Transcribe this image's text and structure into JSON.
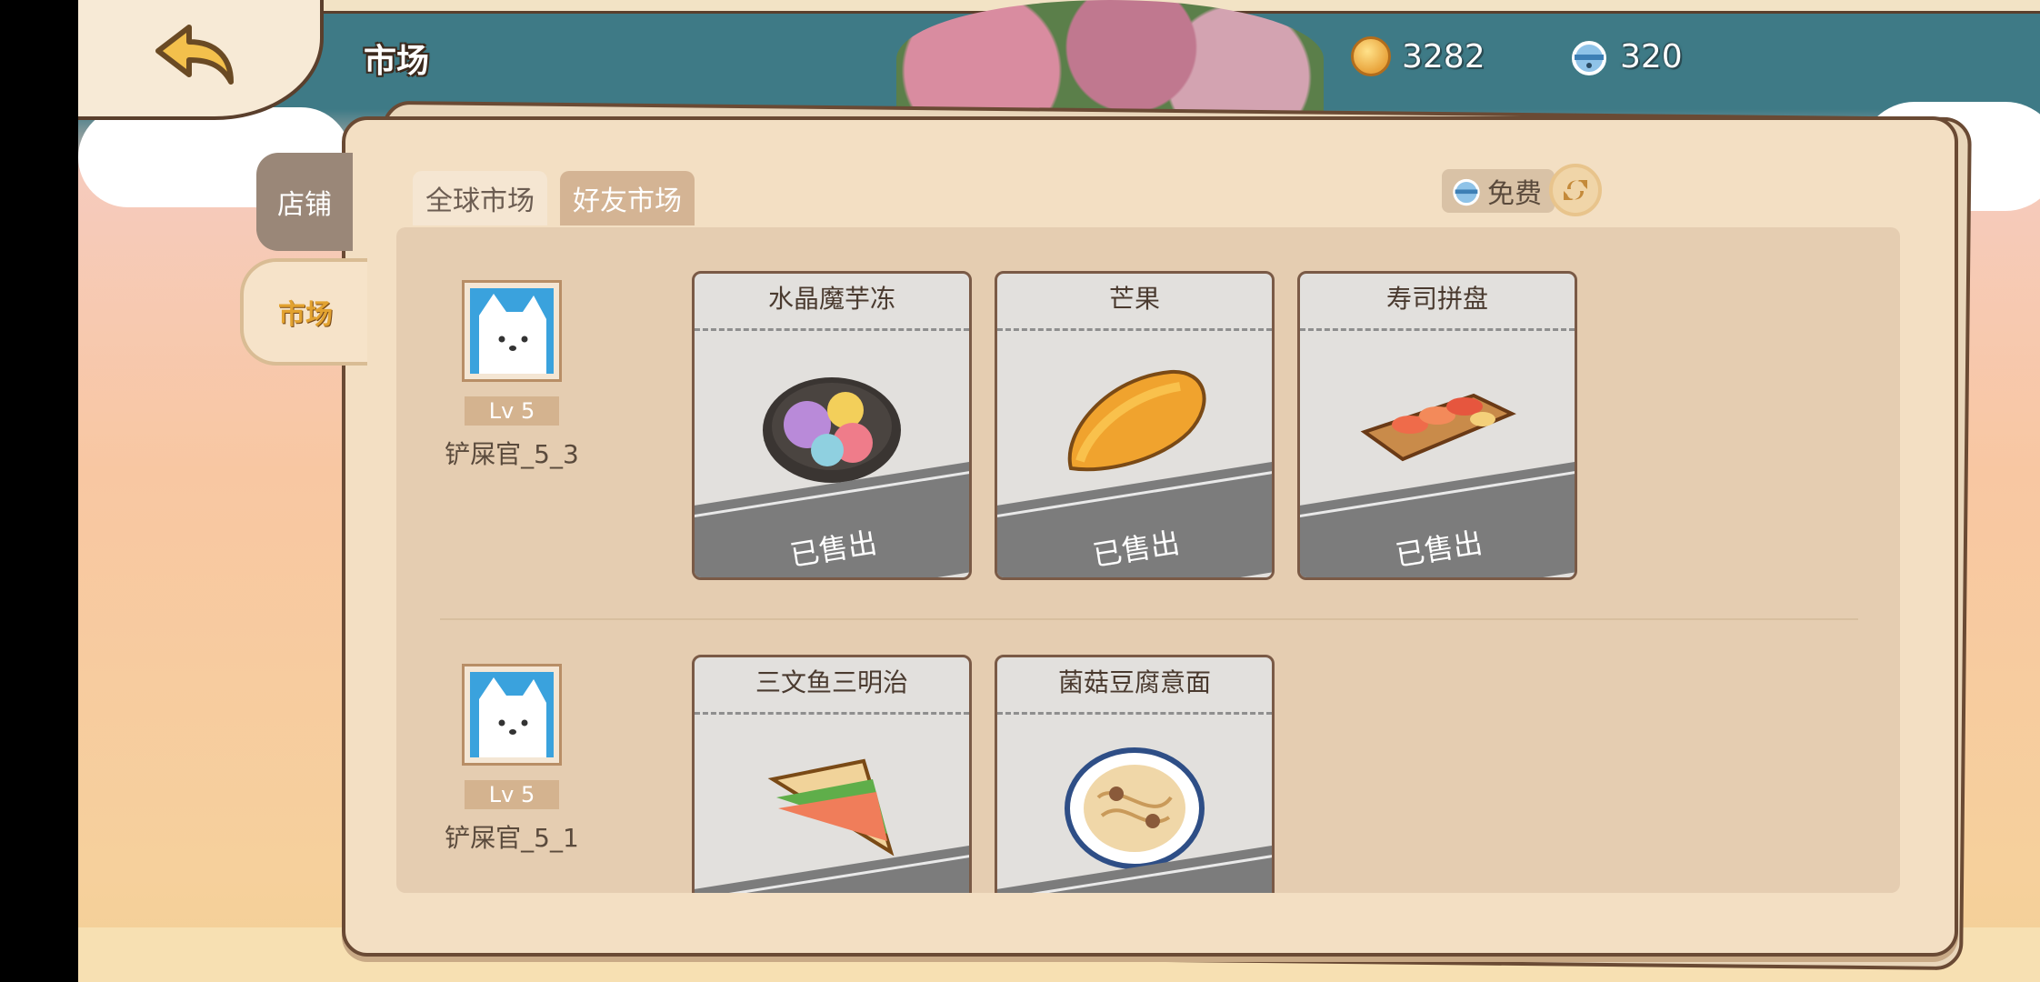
{
  "header": {
    "title": "市场"
  },
  "currencies": [
    {
      "icon": "gold-coin-icon",
      "value": "3282"
    },
    {
      "icon": "bell-icon",
      "value": "320"
    }
  ],
  "side_tabs": [
    {
      "label": "店铺",
      "active": false
    },
    {
      "label": "市场",
      "active": true
    }
  ],
  "market_tabs": [
    {
      "label": "全球市场",
      "active": true
    },
    {
      "label": "好友市场",
      "active": false
    }
  ],
  "refresh": {
    "cost_label": "免费"
  },
  "listings": [
    {
      "seller": {
        "level": "Lv 5",
        "name": "铲屎官_5_3"
      },
      "items": [
        {
          "name": "水晶魔芋冻",
          "status": "已售出",
          "icon": "crystal-jelly-icon"
        },
        {
          "name": "芒果",
          "status": "已售出",
          "icon": "mango-icon"
        },
        {
          "name": "寿司拼盘",
          "status": "已售出",
          "icon": "sushi-platter-icon"
        }
      ]
    },
    {
      "seller": {
        "level": "Lv 5",
        "name": "铲屎官_5_1"
      },
      "items": [
        {
          "name": "三文鱼三明治",
          "status": "",
          "icon": "sandwich-icon"
        },
        {
          "name": "菌菇豆腐意面",
          "status": "",
          "icon": "pasta-icon"
        }
      ]
    }
  ],
  "colors": {
    "accent": "#e2a230",
    "panel": "#f3dfc3",
    "border": "#6a4a34",
    "sold_band": "#7c7c7c"
  }
}
